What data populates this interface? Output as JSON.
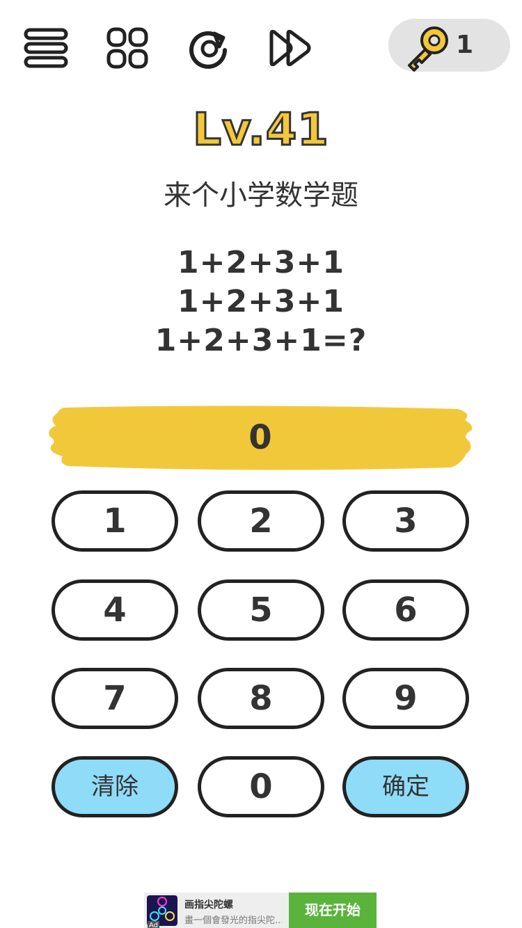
{
  "topbar": {
    "icons": [
      "menu-icon",
      "level-grid-icon",
      "restart-icon",
      "skip-icon",
      "key-icon"
    ],
    "key_count": "1"
  },
  "level": {
    "title": "Lv.41",
    "subtitle": "来个小学数学题"
  },
  "puzzle": {
    "lines": [
      "1+2+3+1",
      "1+2+3+1",
      "1+2+3+1=?"
    ]
  },
  "answer": {
    "value": "0"
  },
  "keypad": {
    "keys": [
      "1",
      "2",
      "3",
      "4",
      "5",
      "6",
      "7",
      "8",
      "9",
      "清除",
      "0",
      "确定"
    ]
  },
  "colors": {
    "level_title": "#f2c83b",
    "answer_bar": "#f2c83b",
    "action_key": "#8fdcf8",
    "ad_cta": "#5ab43c",
    "key_pill": "#e3e3e3"
  },
  "ad": {
    "title": "画指尖陀螺",
    "description": "畫一個會發光的指尖陀...",
    "badge": "Ad",
    "cta": "现在开始"
  }
}
